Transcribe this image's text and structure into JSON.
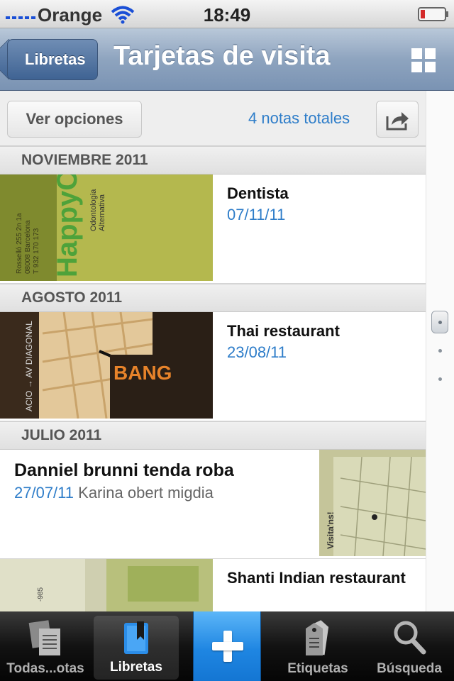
{
  "status_bar": {
    "carrier": "Orange",
    "time": "18:49",
    "icons": [
      "signal-icon",
      "wifi-icon",
      "battery-icon"
    ],
    "battery_color": "#d42a2a"
  },
  "nav_bar": {
    "back_label": "Libretas",
    "title": "Tarjetas de visita",
    "view_icon": "grid-view-icon"
  },
  "toolbar": {
    "options_label": "Ver opciones",
    "note_count": "4 notas totales",
    "share_icon": "share-icon"
  },
  "sections": [
    {
      "header": "NOVIEMBRE 2011",
      "notes": [
        {
          "title": "Dentista",
          "date": "07/11/11",
          "snippet": "",
          "thumb": "business-card-photo-green"
        }
      ]
    },
    {
      "header": "AGOSTO 2011",
      "notes": [
        {
          "title": "Thai restaurant",
          "date": "23/08/11",
          "snippet": "",
          "thumb": "business-card-map-photo"
        }
      ]
    },
    {
      "header": "JULIO 2011",
      "notes": [
        {
          "title": "Danniel brunni tenda roba",
          "date": "27/07/11",
          "snippet": "Karina obert migdia",
          "thumb": "business-card-visitans-photo"
        },
        {
          "title": "Shanti Indian restaurant",
          "date": "",
          "snippet": "",
          "thumb": "business-card-photo"
        }
      ]
    }
  ],
  "tab_bar": {
    "tabs": [
      {
        "label": "Todas...otas",
        "icon": "all-notes-icon",
        "active": false
      },
      {
        "label": "Libretas",
        "icon": "notebooks-icon",
        "active": true
      },
      {
        "label": "",
        "icon": "add-note-icon",
        "active": false
      },
      {
        "label": "Etiquetas",
        "icon": "tags-icon",
        "active": false
      },
      {
        "label": "Búsqueda",
        "icon": "search-icon",
        "active": false
      }
    ]
  },
  "colors": {
    "accent_blue": "#2e7dc9",
    "nav_bar": "#8ea4bf",
    "add_button": "#1f86e2"
  }
}
